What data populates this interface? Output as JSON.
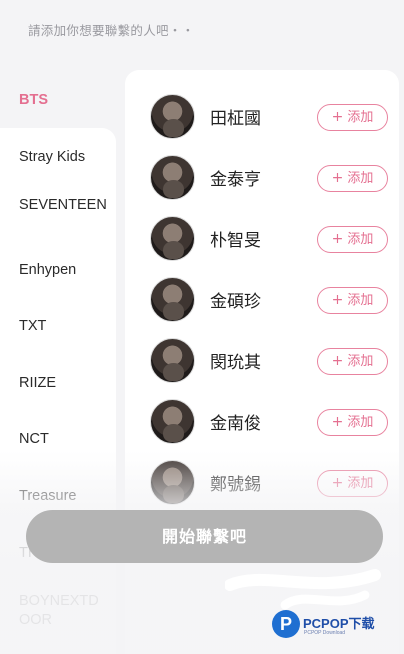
{
  "header": {
    "hint": "請添加你想要聯繫的人吧・・"
  },
  "sidebar": {
    "items": [
      {
        "label": "BTS",
        "active": true
      },
      {
        "label": "Stray Kids"
      },
      {
        "label": "SEVENTEEN"
      },
      {
        "label": "Enhypen"
      },
      {
        "label": "TXT"
      },
      {
        "label": "RIIZE"
      },
      {
        "label": "NCT"
      },
      {
        "label": "Treasure"
      },
      {
        "label": "THE BOYZ"
      },
      {
        "label": "BOYNEXTDOOR"
      }
    ]
  },
  "members": [
    {
      "name": "田柾國"
    },
    {
      "name": "金泰亨"
    },
    {
      "name": "朴智旻"
    },
    {
      "name": "金碩珍"
    },
    {
      "name": "閔玧其"
    },
    {
      "name": "金南俊"
    },
    {
      "name": "鄭號錫"
    }
  ],
  "add_label": "添加",
  "start_button": "開始聯繫吧",
  "watermark": {
    "logo": "P",
    "title": "PCPOP下载",
    "sub": "PCPOP Download"
  },
  "colors": {
    "accent": "#e46f90",
    "disabled_button": "#b4b4b4",
    "background": "#f4f4f6"
  }
}
